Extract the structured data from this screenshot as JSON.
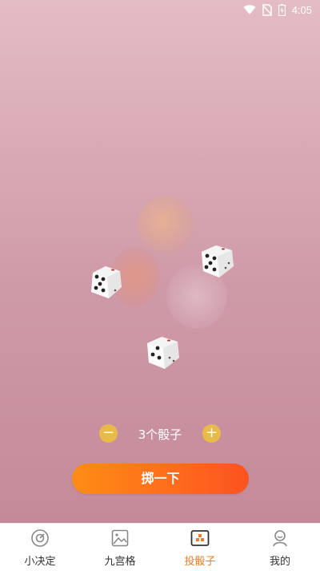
{
  "status_bar": {
    "time": "4:05"
  },
  "counter": {
    "minus_label": "−",
    "plus_label": "+",
    "dice_count_label": "3个骰子"
  },
  "roll_button_label": "掷一下",
  "nav": {
    "items": [
      {
        "label": "小决定",
        "icon": "target-icon"
      },
      {
        "label": "九宫格",
        "icon": "image-icon"
      },
      {
        "label": "投骰子",
        "icon": "dice-tab-icon",
        "active": true
      },
      {
        "label": "我的",
        "icon": "profile-icon"
      }
    ]
  },
  "dice": [
    {
      "face": 5
    },
    {
      "face": 5
    },
    {
      "face": 3
    }
  ],
  "colors": {
    "accent": "#f07b22",
    "button_gradient_start": "#fd8d15",
    "button_gradient_end": "#fb5320",
    "counter_buttons": "#e9b94a",
    "background_top": "#e4bcc4",
    "background_bottom": "#c48a98"
  }
}
